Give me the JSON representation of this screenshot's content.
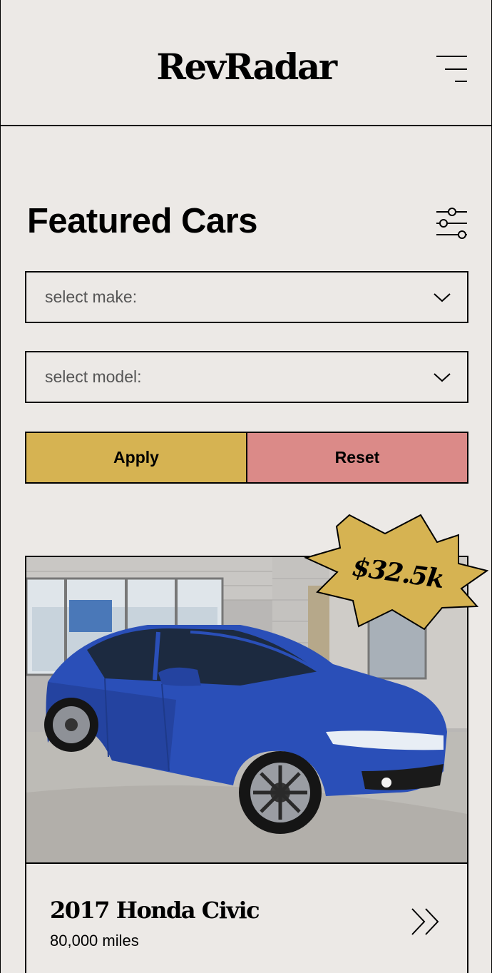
{
  "header": {
    "brand": "RevRadar",
    "menu_icon": "hamburger-menu-icon"
  },
  "main": {
    "title": "Featured Cars",
    "filter_icon": "sliders-filter-icon",
    "make_select": {
      "placeholder": "select make:"
    },
    "model_select": {
      "placeholder": "select model:"
    },
    "apply_label": "Apply",
    "reset_label": "Reset"
  },
  "featured_car": {
    "price_badge": "$32.5k",
    "name": "2017 Honda Civic",
    "mileage": "80,000 miles",
    "arrow_icon": "double-chevron-right-icon"
  },
  "colors": {
    "background": "#ece9e6",
    "apply": "#d6b352",
    "reset": "#db8a88",
    "badge": "#d6b352",
    "car_body": "#2a4fb8"
  }
}
